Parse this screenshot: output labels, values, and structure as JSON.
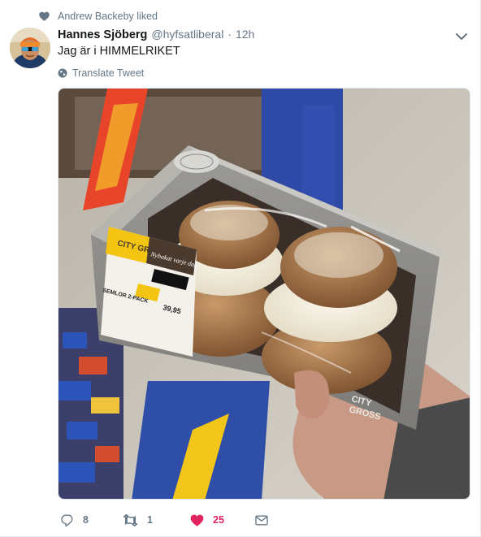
{
  "context": {
    "icon": "heart-icon",
    "text": "Andrew Backeby liked"
  },
  "tweet": {
    "fullname": "Hannes Sjöberg",
    "username": "@hyfsatliberal",
    "separator": "·",
    "time": "12h",
    "text": "Jag är i HIMMELRIKET",
    "translate_label": "Translate Tweet"
  },
  "media": {
    "package_brand": "CITY GROSS",
    "label_slogan": "Nybakat varje dag!",
    "product_name": "SEMLOR 2-PACK",
    "price": "39,95"
  },
  "actions": {
    "reply_count": "8",
    "retweet_count": "1",
    "like_count": "25"
  },
  "colors": {
    "text": "#14171a",
    "secondary": "#657786",
    "like_active": "#e0245e"
  }
}
